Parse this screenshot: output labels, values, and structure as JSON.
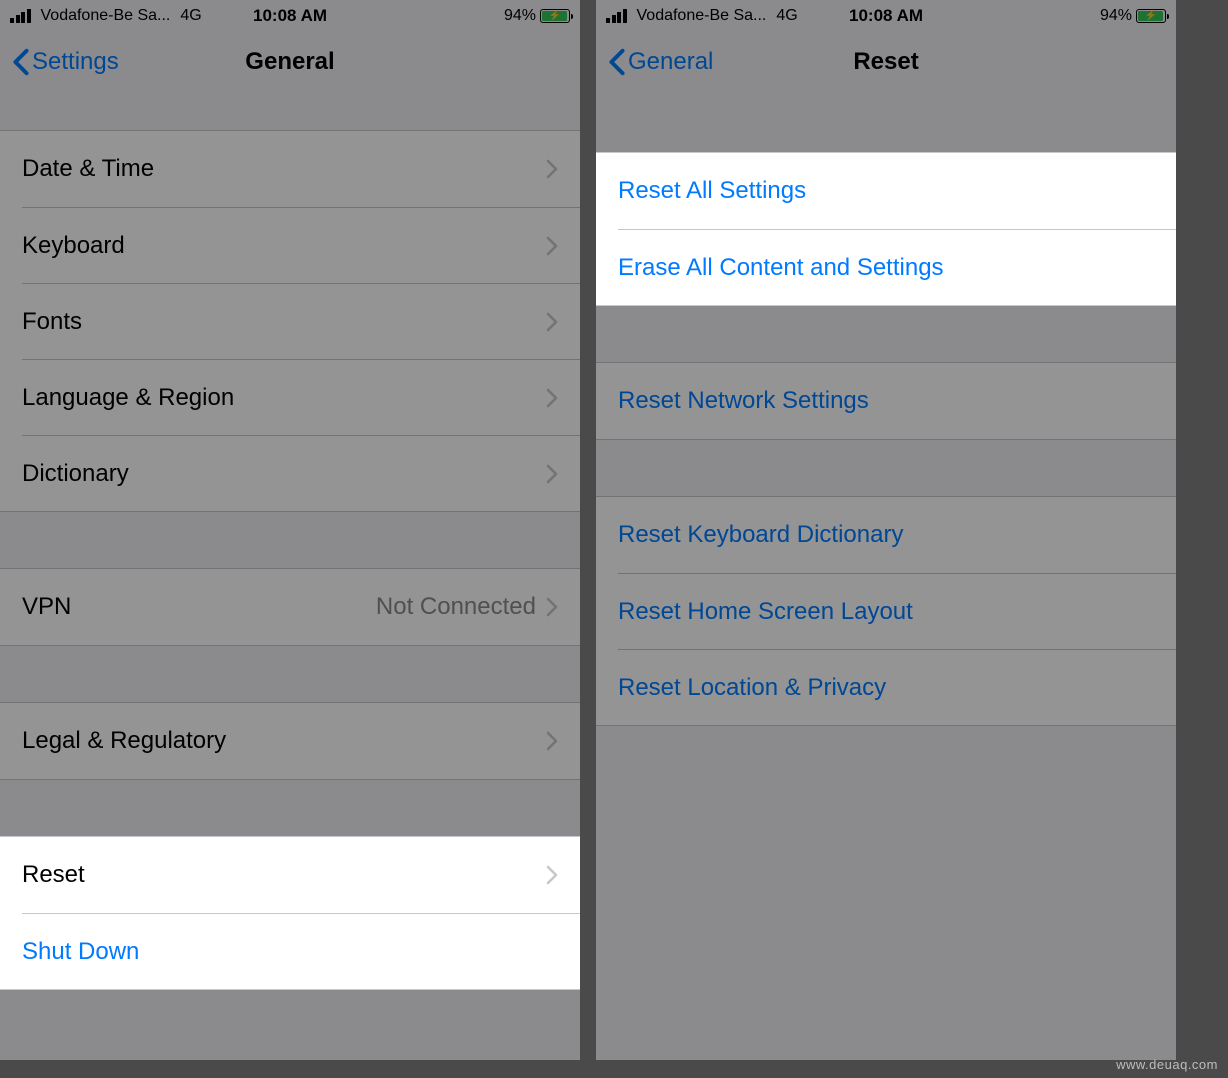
{
  "statusbar": {
    "carrier": "Vodafone-Be Sa...",
    "network": "4G",
    "time": "10:08 AM",
    "battery_pct": "94%"
  },
  "left": {
    "back_label": "Settings",
    "title": "General",
    "group1": {
      "date_time": "Date & Time",
      "keyboard": "Keyboard",
      "fonts": "Fonts",
      "language_region": "Language & Region",
      "dictionary": "Dictionary"
    },
    "group2": {
      "vpn": "VPN",
      "vpn_status": "Not Connected"
    },
    "group3": {
      "legal": "Legal & Regulatory"
    },
    "group4": {
      "reset": "Reset",
      "shutdown": "Shut Down"
    }
  },
  "right": {
    "back_label": "General",
    "title": "Reset",
    "group1": {
      "reset_all": "Reset All Settings",
      "erase_all": "Erase All Content and Settings"
    },
    "group2": {
      "reset_network": "Reset Network Settings"
    },
    "group3": {
      "reset_keyboard_dict": "Reset Keyboard Dictionary",
      "reset_home_layout": "Reset Home Screen Layout",
      "reset_location_privacy": "Reset Location & Privacy"
    }
  },
  "watermark": "www.deuaq.com"
}
